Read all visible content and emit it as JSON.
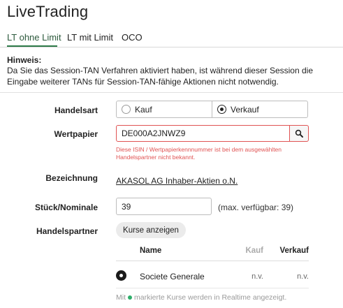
{
  "app": {
    "title": "LiveTrading"
  },
  "tabs": [
    {
      "label": "LT ohne Limit",
      "active": true
    },
    {
      "label": "LT mit Limit",
      "active": false
    },
    {
      "label": "OCO",
      "active": false
    }
  ],
  "hint": {
    "title": "Hinweis:",
    "text": "Da Sie das Session-TAN Verfahren aktiviert haben, ist während dieser Session die Eingabe weiterer TANs für Session-TAN-fähige Aktionen nicht notwendig."
  },
  "form": {
    "handelsart": {
      "label": "Handelsart",
      "options": [
        {
          "label": "Kauf",
          "selected": false
        },
        {
          "label": "Verkauf",
          "selected": true
        }
      ]
    },
    "wertpapier": {
      "label": "Wertpapier",
      "value": "DE000A2JNWZ9",
      "search_icon": "search-icon",
      "error": "Diese ISIN / Wertpapierkennnummer ist bei dem ausgewählten Handelspartner nicht bekannt."
    },
    "bezeichnung": {
      "label": "Bezeichnung",
      "value": "AKASOL AG Inhaber-Aktien o.N."
    },
    "stueck": {
      "label": "Stück/Nominale",
      "value": "39",
      "available": "(max. verfügbar: 39)"
    },
    "handelspartner": {
      "label": "Handelspartner",
      "button": "Kurse anzeigen",
      "columns": {
        "name": "Name",
        "kauf": "Kauf",
        "verkauf": "Verkauf"
      },
      "rows": [
        {
          "name": "Societe Generale",
          "kauf": "n.v.",
          "verkauf": "n.v.",
          "selected": true
        }
      ],
      "legend_prefix": "Mit",
      "legend_suffix": "markierte Kurse werden in Realtime angezeigt.",
      "legend_dot_color": "#2eae6a"
    }
  },
  "colors": {
    "accent": "#2d7a48",
    "error": "#e05353"
  }
}
